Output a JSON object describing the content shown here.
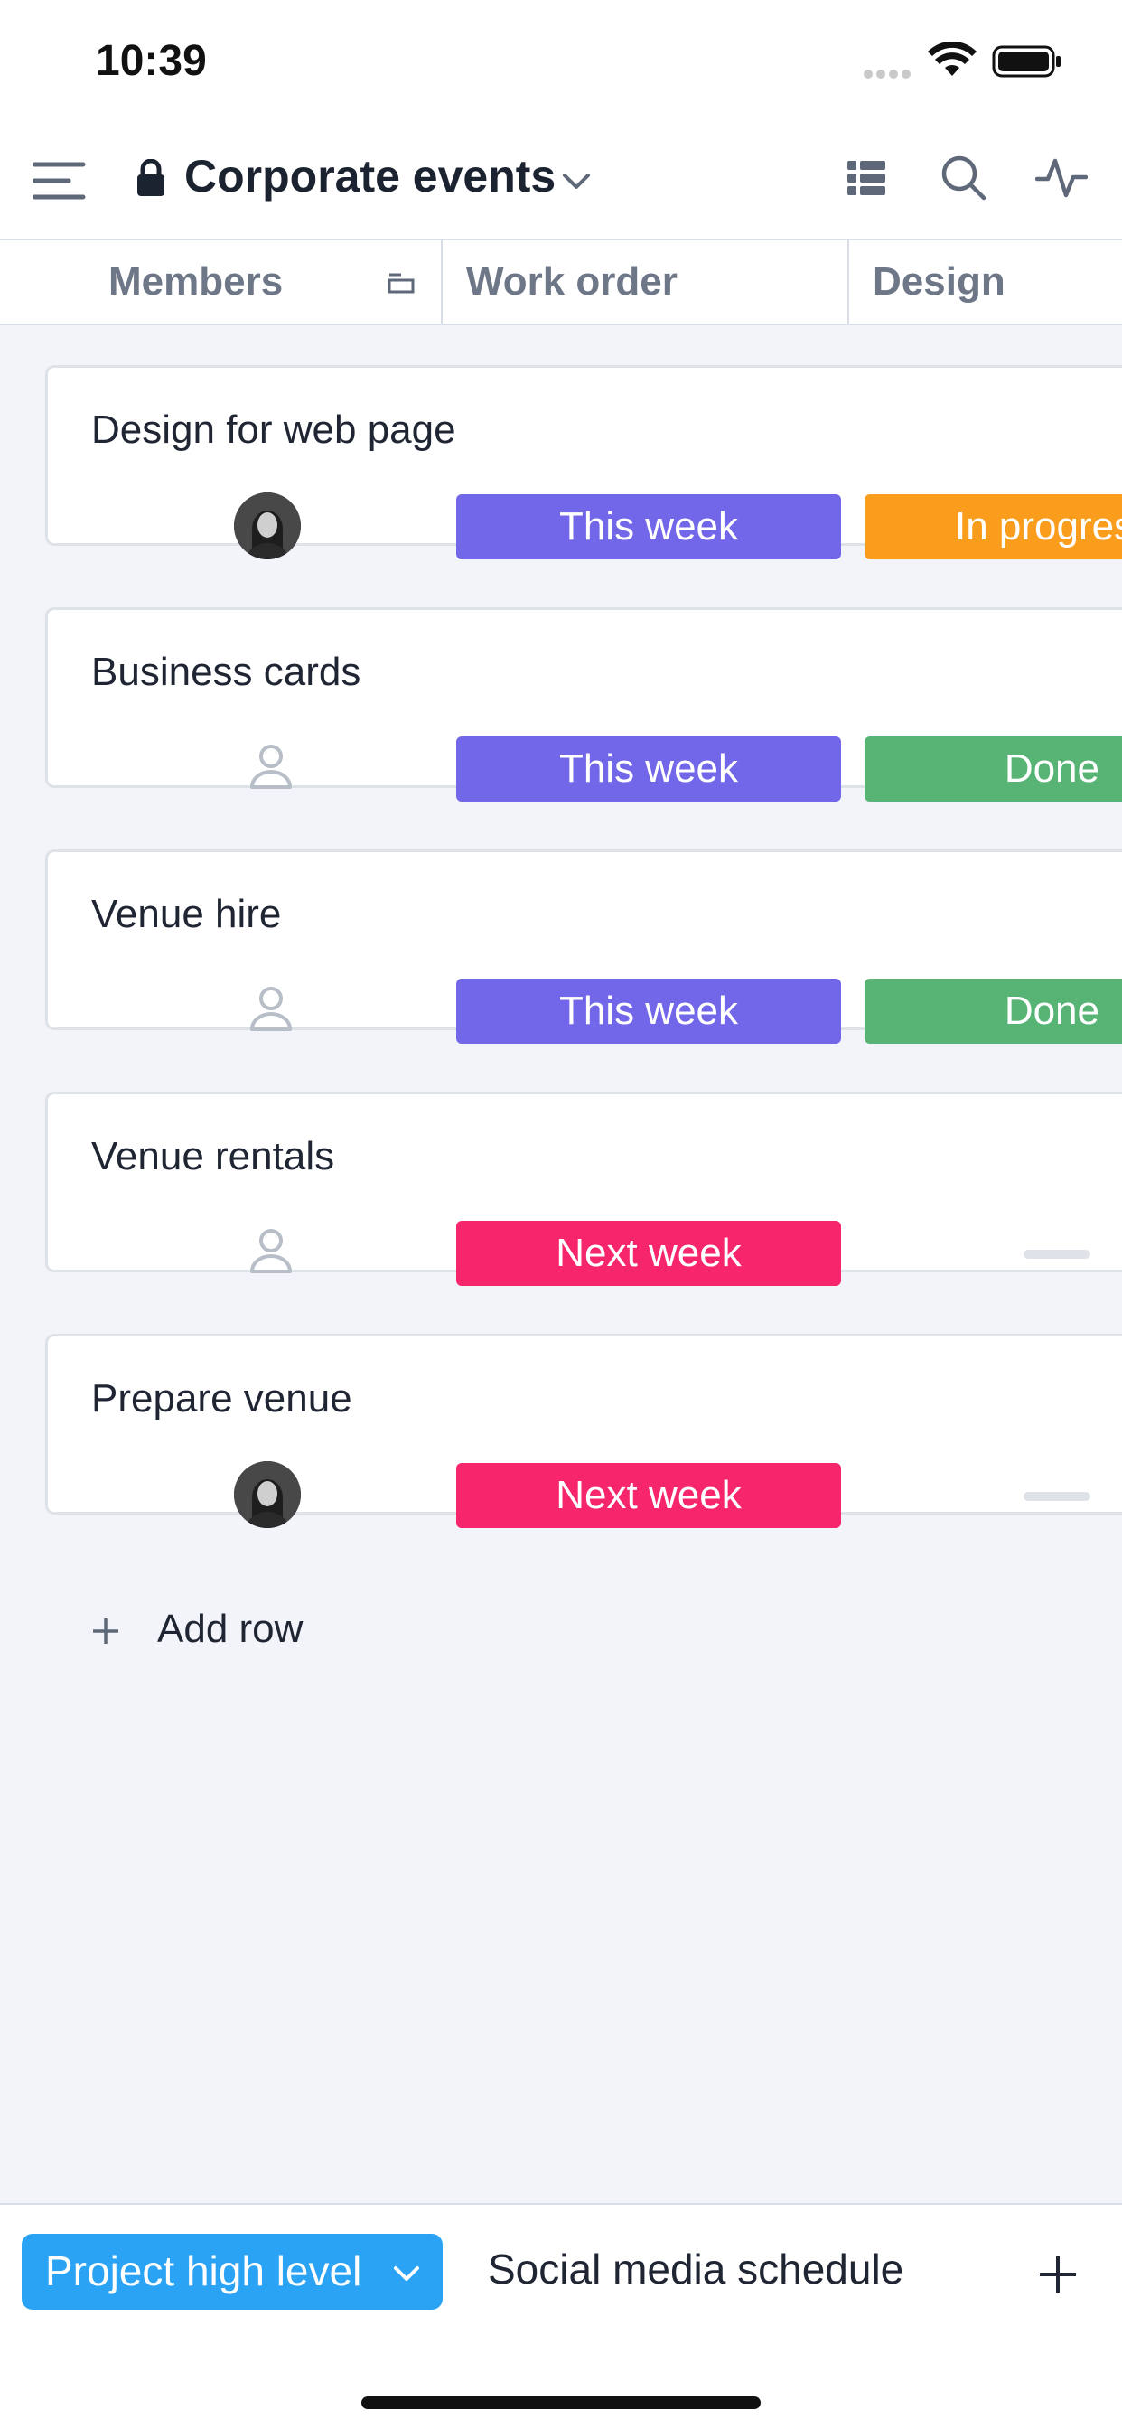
{
  "status_bar": {
    "time": "10:39"
  },
  "header": {
    "title": "Corporate events"
  },
  "columns": {
    "members": "Members",
    "work_order": "Work order",
    "design": "Design"
  },
  "rows": [
    {
      "title": "Design for web page",
      "member": "avatar",
      "work_order": "This week",
      "work_order_color": "#7266e9",
      "design": "In progress",
      "design_color": "#fb9d1c"
    },
    {
      "title": "Business cards",
      "member": "empty",
      "work_order": "This week",
      "work_order_color": "#7266e9",
      "design": "Done",
      "design_color": "#57b474"
    },
    {
      "title": "Venue hire",
      "member": "empty",
      "work_order": "This week",
      "work_order_color": "#7266e9",
      "design": "Done",
      "design_color": "#57b474"
    },
    {
      "title": "Venue rentals",
      "member": "empty",
      "work_order": "Next week",
      "work_order_color": "#f7266c",
      "design": "",
      "design_color": ""
    },
    {
      "title": "Prepare venue",
      "member": "avatar",
      "work_order": "Next week",
      "work_order_color": "#f7266c",
      "design": "",
      "design_color": ""
    }
  ],
  "add_row_label": "Add row",
  "tabs": {
    "active": "Project high level",
    "inactive": "Social media schedule"
  },
  "colors": {
    "accent": "#2aa3f5",
    "background": "#f2f4f9"
  },
  "icons": [
    "menu-icon",
    "lock-icon",
    "chevron-down-icon",
    "list-view-icon",
    "search-icon",
    "activity-icon",
    "collapse-column-icon",
    "person-icon",
    "plus-icon"
  ]
}
